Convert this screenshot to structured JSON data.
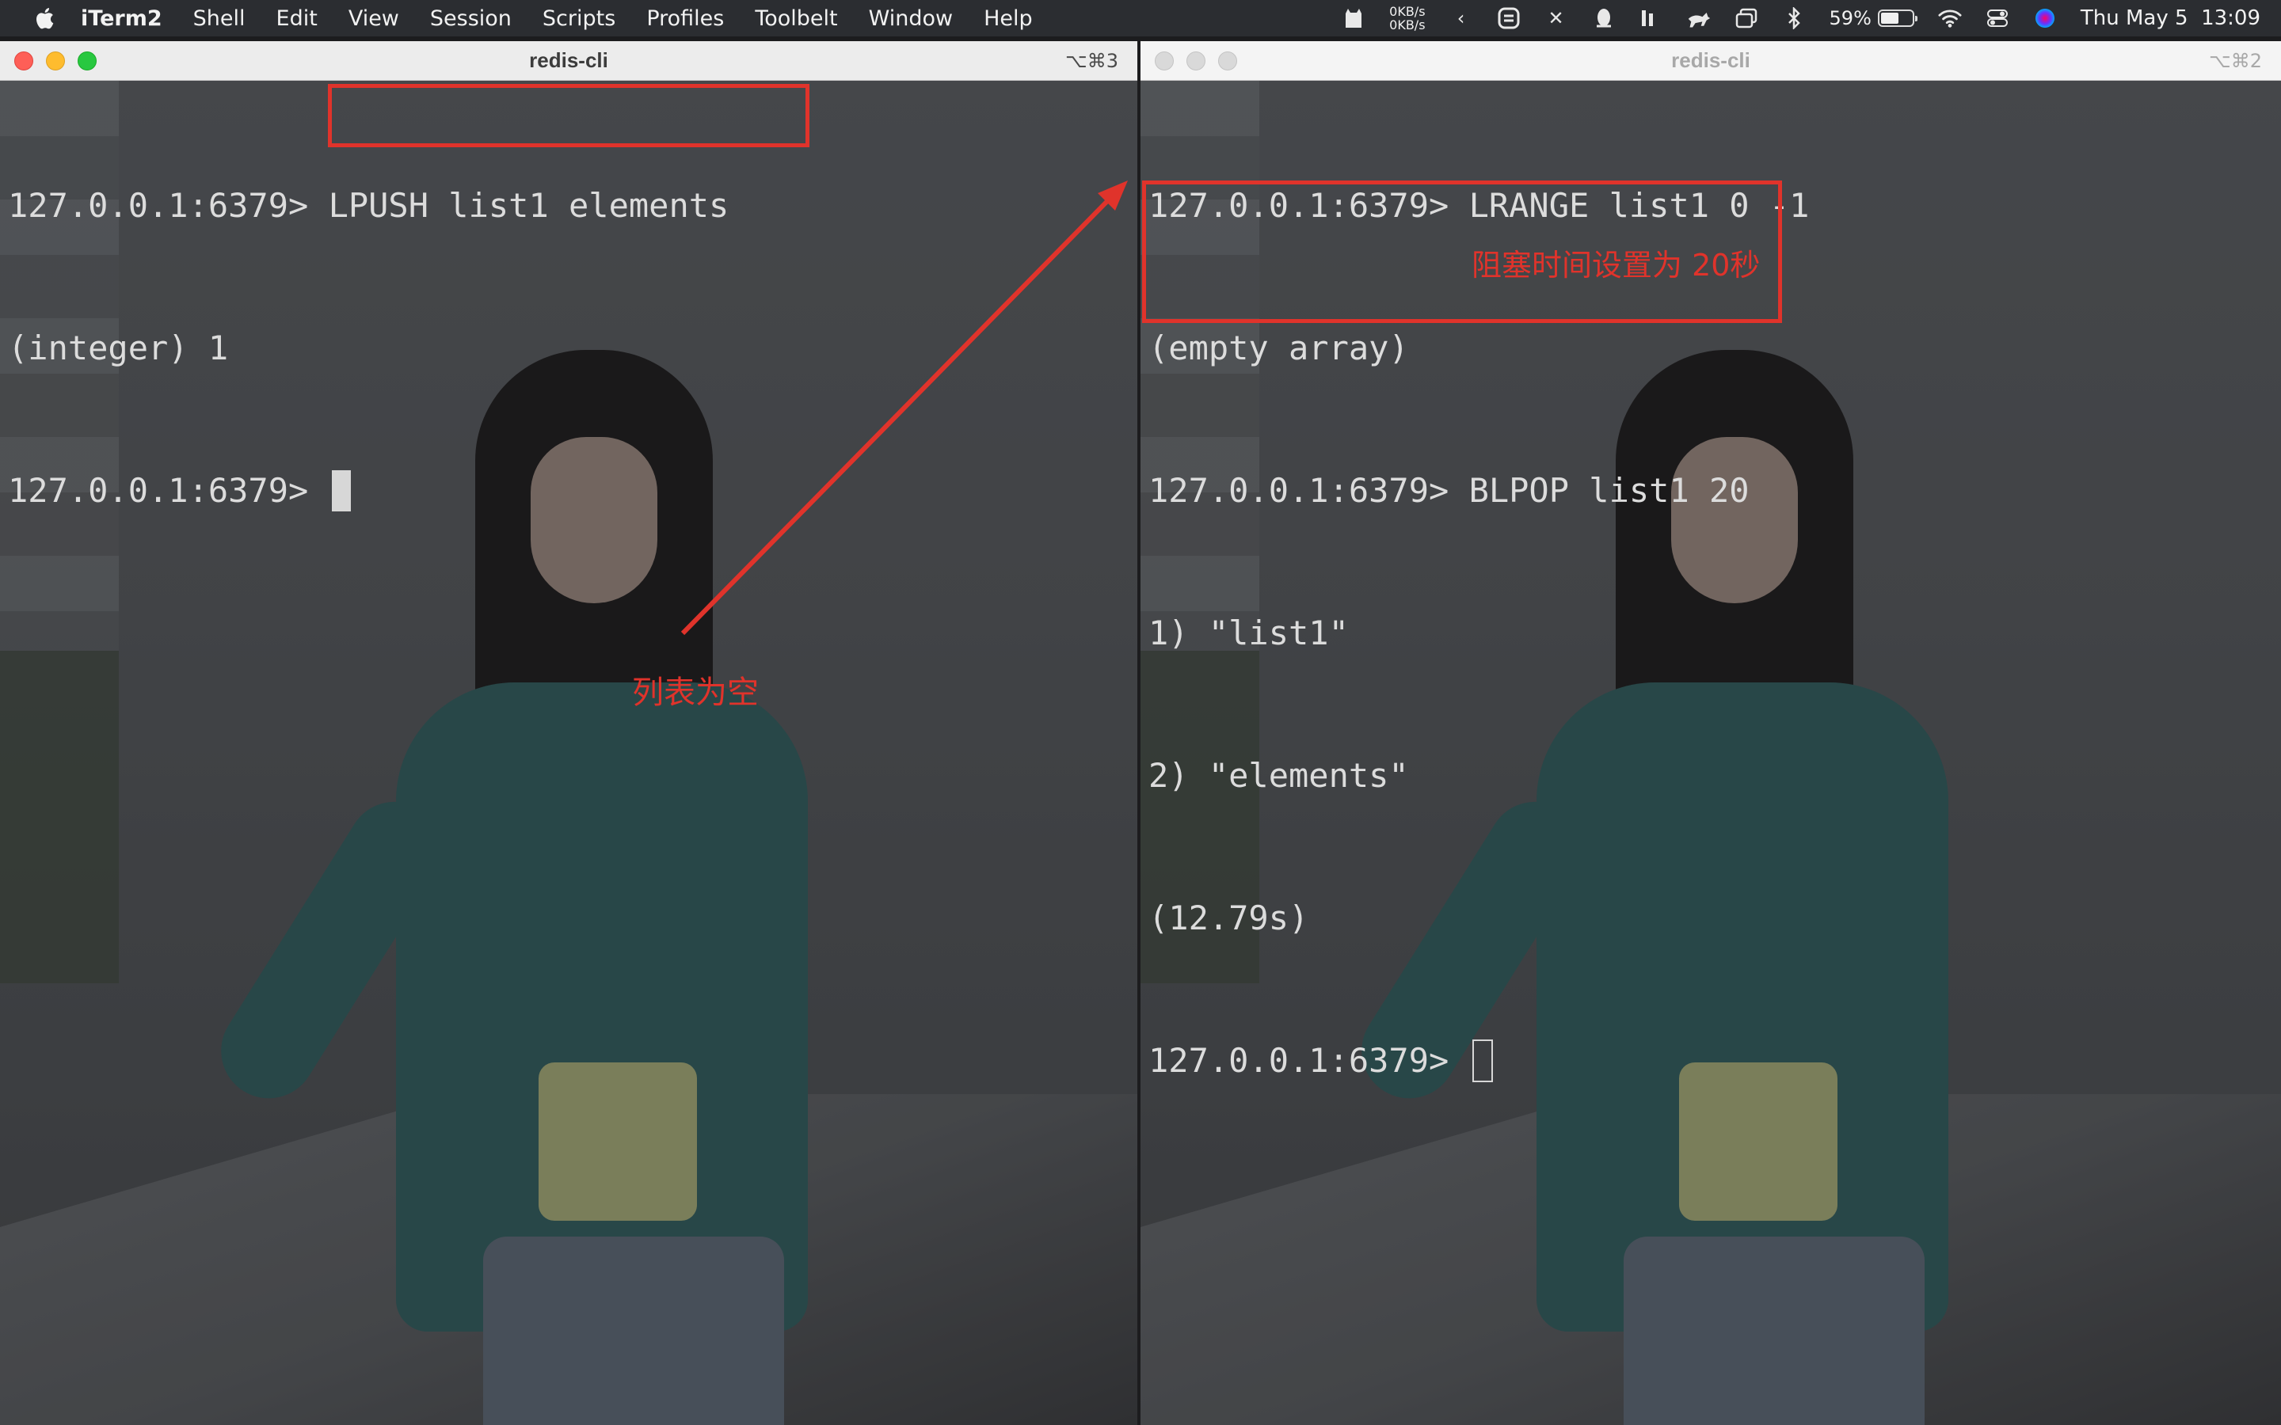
{
  "menubar": {
    "app": "iTerm2",
    "items": [
      "Shell",
      "Edit",
      "View",
      "Session",
      "Scripts",
      "Profiles",
      "Toolbelt",
      "Window",
      "Help"
    ],
    "net_up": "0KB/s",
    "net_down": "0KB/s",
    "battery_percent": "59%",
    "battery_level": 0.59,
    "datetime": "Thu May 5  13:09"
  },
  "windows": {
    "left": {
      "title": "redis-cli",
      "shortcut": "⌥⌘3",
      "lines": [
        {
          "prompt": "127.0.0.1:6379> ",
          "text": "LPUSH list1 elements"
        },
        {
          "prompt": "",
          "text": "(integer) 1"
        },
        {
          "prompt": "127.0.0.1:6379> ",
          "text": ""
        }
      ]
    },
    "right": {
      "title": "redis-cli",
      "shortcut": "⌥⌘2",
      "lines": [
        {
          "prompt": "127.0.0.1:6379> ",
          "text": "LRANGE list1 0 -1"
        },
        {
          "prompt": "",
          "text": "(empty array)"
        },
        {
          "prompt": "127.0.0.1:6379> ",
          "text": "BLPOP list1 20"
        },
        {
          "prompt": "",
          "text": "1) \"list1\""
        },
        {
          "prompt": "",
          "text": "2) \"elements\""
        },
        {
          "prompt": "",
          "text": "(12.79s)"
        },
        {
          "prompt": "127.0.0.1:6379> ",
          "text": ""
        }
      ]
    }
  },
  "annotations": {
    "empty_list": "列表为空",
    "block_time": "阻塞时间设置为 20秒",
    "color": "#e0332b"
  }
}
